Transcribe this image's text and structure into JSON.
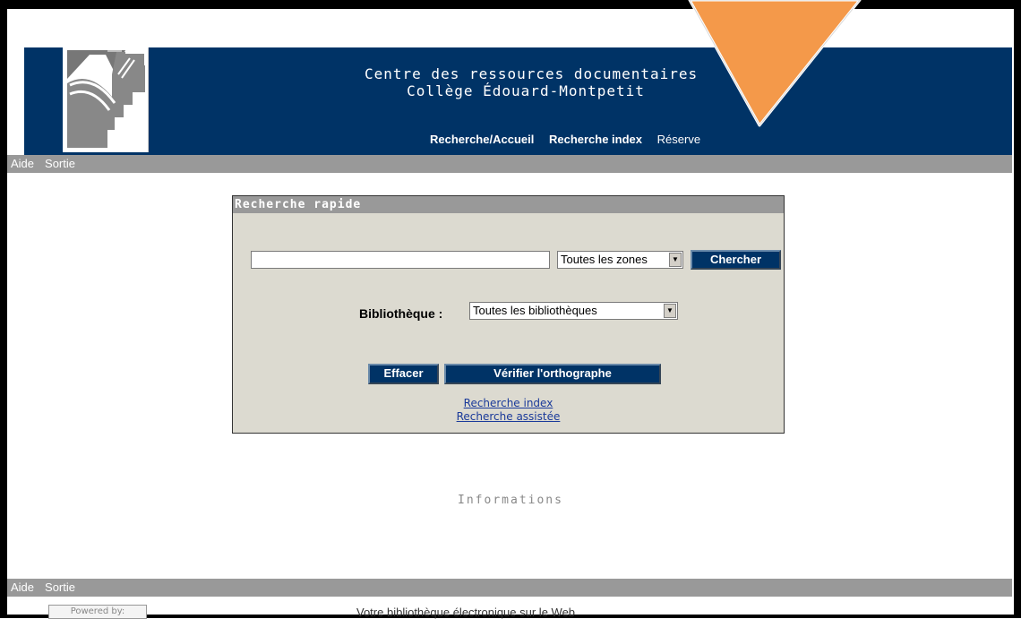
{
  "header": {
    "title_line1": "Centre des ressources documentaires",
    "title_line2": "Collège Édouard-Montpetit",
    "nav": [
      "Recherche/Accueil",
      "Recherche index",
      "Réserve"
    ]
  },
  "toolbar": {
    "help": "Aide",
    "exit": "Sortie"
  },
  "search_panel": {
    "title": "Recherche rapide",
    "query_value": "",
    "zone_select": "Toutes les zones",
    "search_button": "Chercher",
    "library_label": "Bibliothèque :",
    "library_select": "Toutes les bibliothèques",
    "clear_button": "Effacer",
    "spellcheck_button": "Vérifier l'orthographe",
    "links": [
      "Recherche index",
      "Recherche assistée"
    ]
  },
  "info": {
    "title": "Informations"
  },
  "footer": {
    "help": "Aide",
    "exit": "Sortie",
    "powered_by": "Powered by:",
    "tagline": "Votre bibliothèque électronique sur le Web"
  },
  "colors": {
    "header_bg": "#003366",
    "bar_gray": "#999999",
    "panel_bg": "#dcdad0",
    "button_bg": "#003366",
    "annotation_arrow": "#f4994a"
  }
}
